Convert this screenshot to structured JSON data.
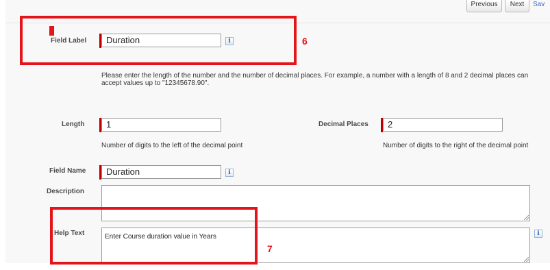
{
  "toolbar": {
    "previous_label": "Previous",
    "next_label": "Next",
    "link_label": "Sav"
  },
  "form": {
    "field_label": {
      "label": "Field Label",
      "value": "Duration"
    },
    "instructions": "Please enter the length of the number and the number of decimal places. For example, a number with a length of 8 and 2 decimal places can accept values up to \"12345678.90\".",
    "length": {
      "label": "Length",
      "value": "1",
      "hint": "Number of digits to the left of the decimal point"
    },
    "decimal_places": {
      "label": "Decimal Places",
      "value": "2",
      "hint": "Number of digits to the right of the decimal point"
    },
    "field_name": {
      "label": "Field Name",
      "value": "Duration"
    },
    "description": {
      "label": "Description",
      "value": ""
    },
    "help_text": {
      "label": "Help Text",
      "value": "Enter Course duration value in Years"
    },
    "info_glyph": "i"
  },
  "annotations": {
    "callout_6": "6",
    "callout_7": "7",
    "color": "#e3151a"
  },
  "colors": {
    "required_marker": "#c00000",
    "panel_background": "#f8f8f8"
  }
}
